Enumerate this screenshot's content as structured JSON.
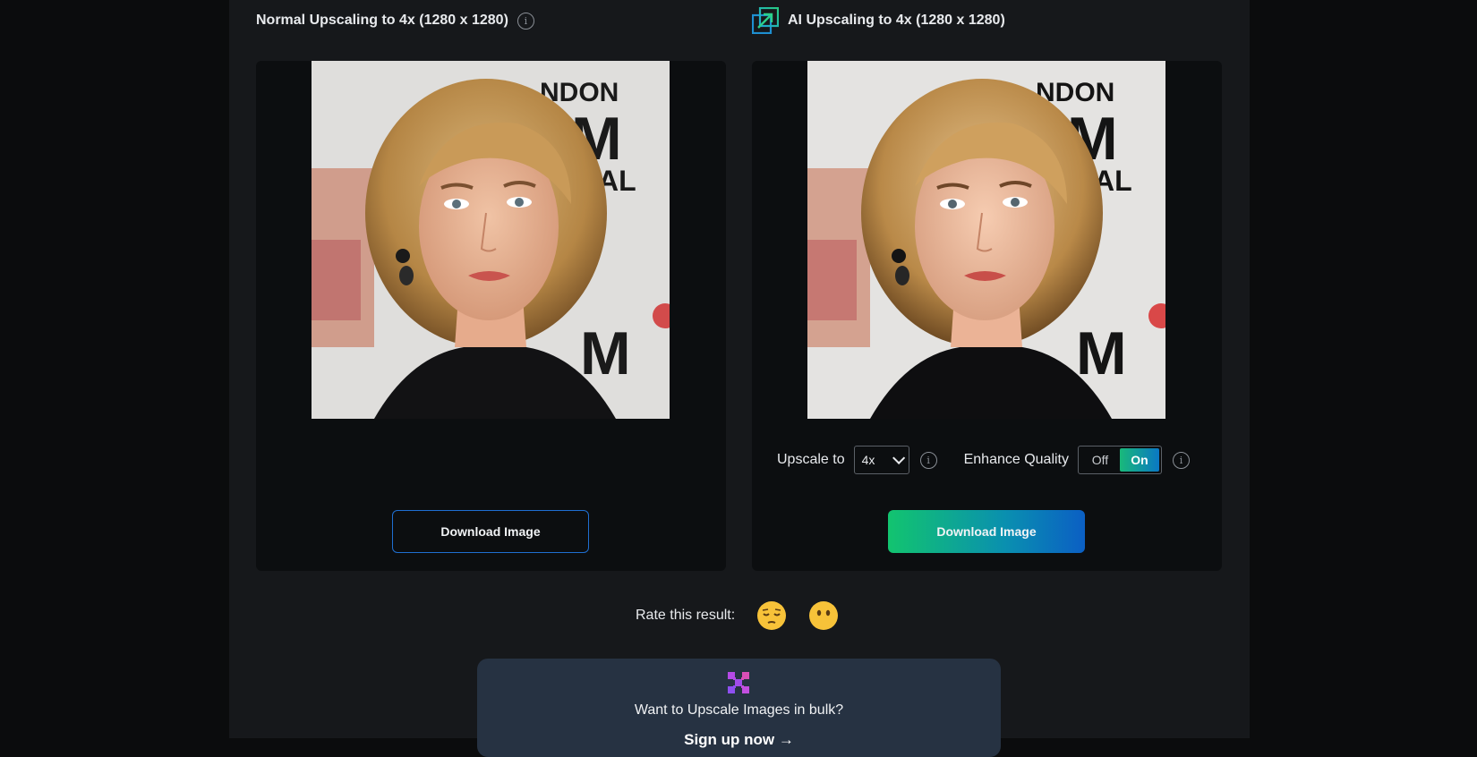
{
  "left_column": {
    "title": "Normal Upscaling to 4x (1280 x 1280)",
    "info_glyph": "i",
    "download_label": "Download Image"
  },
  "right_column": {
    "title": "AI Upscaling to 4x (1280 x 1280)",
    "logo_icon": "ai-upscale-logo-icon",
    "upscale_label": "Upscale to",
    "upscale_value": "4x",
    "enhance_label": "Enhance Quality",
    "toggle_off": "Off",
    "toggle_on": "On",
    "info_glyph": "i",
    "download_label": "Download Image"
  },
  "rating": {
    "label": "Rate this result:",
    "options": [
      "relieved-face-icon",
      "face-without-mouth-icon"
    ]
  },
  "bulk": {
    "icon": "bulk-puzzle-icon",
    "text": "Want to Upscale Images in bulk?",
    "link": "Sign up now →"
  },
  "colors": {
    "page_bg": "#0b0c0d",
    "content_bg": "#16181b",
    "panel_bg": "#0c0e10",
    "accent_blue": "#1f6fd1",
    "accent_green": "#12c46f",
    "bulk_bg": "#263242"
  }
}
